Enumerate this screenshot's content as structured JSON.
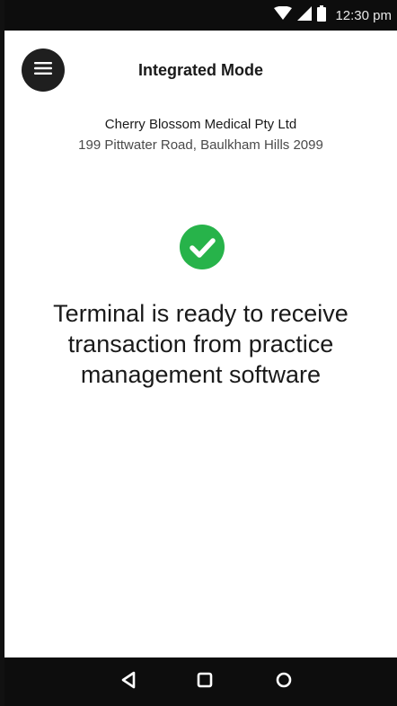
{
  "status_bar": {
    "time": "12:30 pm",
    "icons": [
      "wifi-icon",
      "cell-signal-icon",
      "battery-icon"
    ]
  },
  "app_bar": {
    "title": "Integrated Mode",
    "menu_icon": "hamburger-menu-icon"
  },
  "merchant": {
    "name": "Cherry Blossom Medical Pty Ltd",
    "address": "199 Pittwater Road, Baulkham Hills 2099"
  },
  "status": {
    "icon": "check-circle-icon",
    "color": "#27b34a",
    "message": "Terminal is ready to receive transaction from practice management software"
  },
  "nav_bar": {
    "buttons": [
      "back-icon",
      "home-icon",
      "recents-icon"
    ]
  },
  "colors": {
    "status_bar": "#0d0d0d",
    "nav_bar": "#0d0d0d",
    "menu_button": "#1f1f1f",
    "success": "#27b34a"
  }
}
